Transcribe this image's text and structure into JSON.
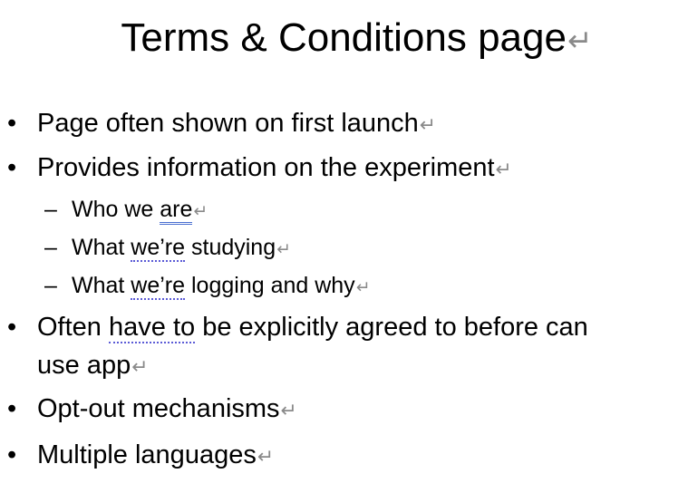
{
  "slide": {
    "title": "Terms & Conditions page",
    "pilcrow": "↵",
    "bullet": "•",
    "dash": "–",
    "items": [
      {
        "text": "Page often shown on first launch"
      },
      {
        "text": "Provides information on the experiment"
      },
      {
        "pre": "Who we ",
        "mark": "are",
        "post": ""
      },
      {
        "pre": "What ",
        "mark": "we’re",
        "post": " studying"
      },
      {
        "pre": "What ",
        "mark": "we’re",
        "post": " logging and why"
      },
      {
        "pre": "Often ",
        "mark": "have to",
        "post": " be explicitly agreed to before can",
        "cont": "use app"
      },
      {
        "text": "Opt-out mechanisms"
      },
      {
        "text": "Multiple languages"
      }
    ]
  }
}
